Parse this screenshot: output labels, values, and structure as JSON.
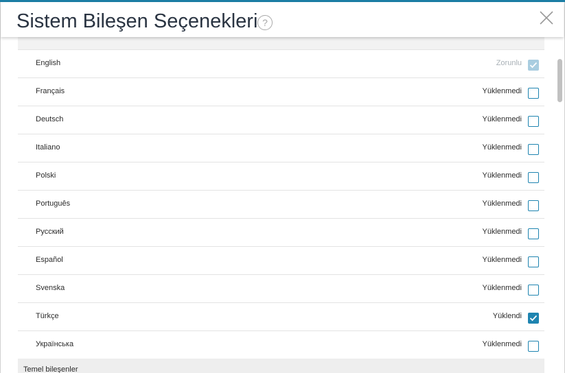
{
  "dialog": {
    "title": "Sistem Bileşen Seçenekleri",
    "help_symbol": "?",
    "accent_color": "#1e84b0"
  },
  "languages": [
    {
      "name": "English",
      "status": "Zorunlu",
      "checked": true,
      "required": true
    },
    {
      "name": "Français",
      "status": "Yüklenmedi",
      "checked": false,
      "required": false
    },
    {
      "name": "Deutsch",
      "status": "Yüklenmedi",
      "checked": false,
      "required": false
    },
    {
      "name": "Italiano",
      "status": "Yüklenmedi",
      "checked": false,
      "required": false
    },
    {
      "name": "Polski",
      "status": "Yüklenmedi",
      "checked": false,
      "required": false
    },
    {
      "name": "Português",
      "status": "Yüklenmedi",
      "checked": false,
      "required": false
    },
    {
      "name": "Русский",
      "status": "Yüklenmedi",
      "checked": false,
      "required": false
    },
    {
      "name": "Español",
      "status": "Yüklenmedi",
      "checked": false,
      "required": false
    },
    {
      "name": "Svenska",
      "status": "Yüklenmedi",
      "checked": false,
      "required": false
    },
    {
      "name": "Türkçe",
      "status": "Yüklendi",
      "checked": true,
      "required": false
    },
    {
      "name": "Українська",
      "status": "Yüklenmedi",
      "checked": false,
      "required": false
    }
  ],
  "sections": {
    "core_title": "Temel bileşenler"
  }
}
